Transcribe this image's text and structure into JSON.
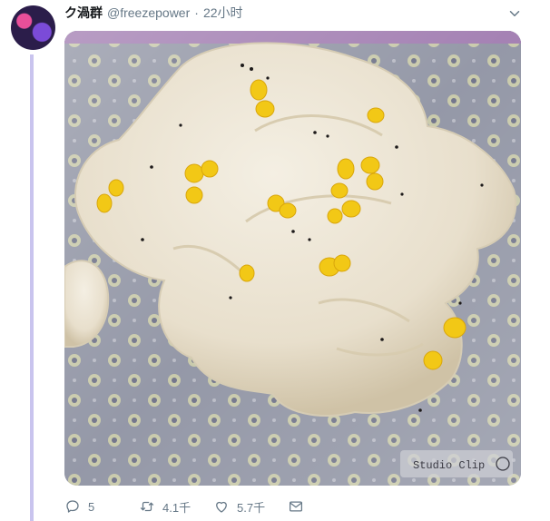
{
  "tweet": {
    "display_name": "ク渦群",
    "handle": "@freezepower",
    "separator": "·",
    "time": "22小时",
    "photo": {
      "watermark": "Studio Clip"
    },
    "actions": {
      "reply_count": "5",
      "retweet_count": "4.1千",
      "like_count": "5.7千"
    }
  },
  "colors": {
    "accent": "#1da1f2",
    "thread_line": "#c9c4ee",
    "muted_text": "#657786"
  },
  "icons": [
    "chevron-down-icon",
    "reply-icon",
    "retweet-icon",
    "heart-icon",
    "message-icon"
  ]
}
